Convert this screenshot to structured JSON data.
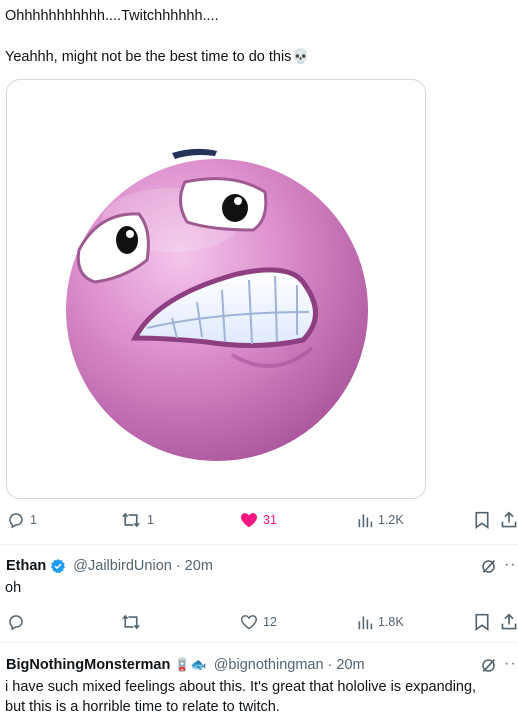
{
  "main_tweet": {
    "line1": "Ohhhhhhhhhhh....Twitchhhhhh....",
    "line2": "Yeahhh, might not be the best time to do this",
    "line2_emoji": "💀",
    "actions": {
      "replies": "1",
      "reposts": "1",
      "likes": "31",
      "views": "1.2K"
    }
  },
  "replies": [
    {
      "name": "Ethan",
      "handle": "@JailbirdUnion",
      "time": "· 20m",
      "text": "oh",
      "actions": {
        "replies": "",
        "reposts": "",
        "likes": "12",
        "views": "1.8K"
      }
    },
    {
      "name": "BigNothingMonsterman",
      "name_emojis": "🪫🐟",
      "handle": "@bignothingman",
      "time": "· 20m",
      "text_line1": "i have such mixed feelings about this. It's great that hololive is expanding,",
      "text_line2": "but this is a horrible time to relate to twitch."
    }
  ],
  "colors": {
    "like_active": "#f91880",
    "verified": "#1d9bf0",
    "muted": "#536471"
  }
}
